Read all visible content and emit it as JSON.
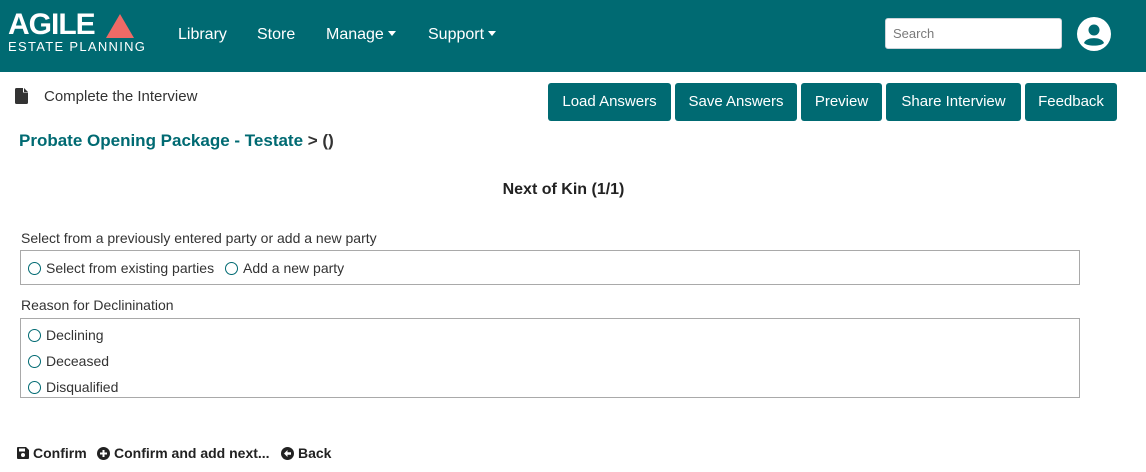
{
  "navbar": {
    "logo_word": "AGILE",
    "logo_sub": "ESTATE PLANNING",
    "links": [
      "Library",
      "Store",
      "Manage",
      "Support"
    ],
    "search_placeholder": "Search",
    "bg_color": "#006a72",
    "logo_accent": "#ee6a66"
  },
  "toolbar": {
    "page_title": "Complete the Interview",
    "buttons": [
      "Load Answers",
      "Save Answers",
      "Preview",
      "Share Interview",
      "Feedback"
    ]
  },
  "breadcrumb": {
    "link": "Probate Opening Package - Testate",
    "rest": " > ()"
  },
  "section": {
    "title": "Next of Kin (1/1)",
    "party_label": "Select from a previously entered party or add a new party",
    "party_options": [
      "Select from existing parties",
      "Add a new party"
    ],
    "reason_label": "Reason for Declinination",
    "reason_options": [
      "Declining",
      "Deceased",
      "Disqualified"
    ]
  },
  "actions": {
    "confirm": "Confirm",
    "confirm_next": "Confirm and add next...",
    "back": "Back"
  },
  "icons": {
    "page": "file-icon",
    "user": "user-circle-icon",
    "confirm": "save-icon",
    "confirm_next": "plus-circle-icon",
    "back": "arrow-left-circle-icon"
  }
}
